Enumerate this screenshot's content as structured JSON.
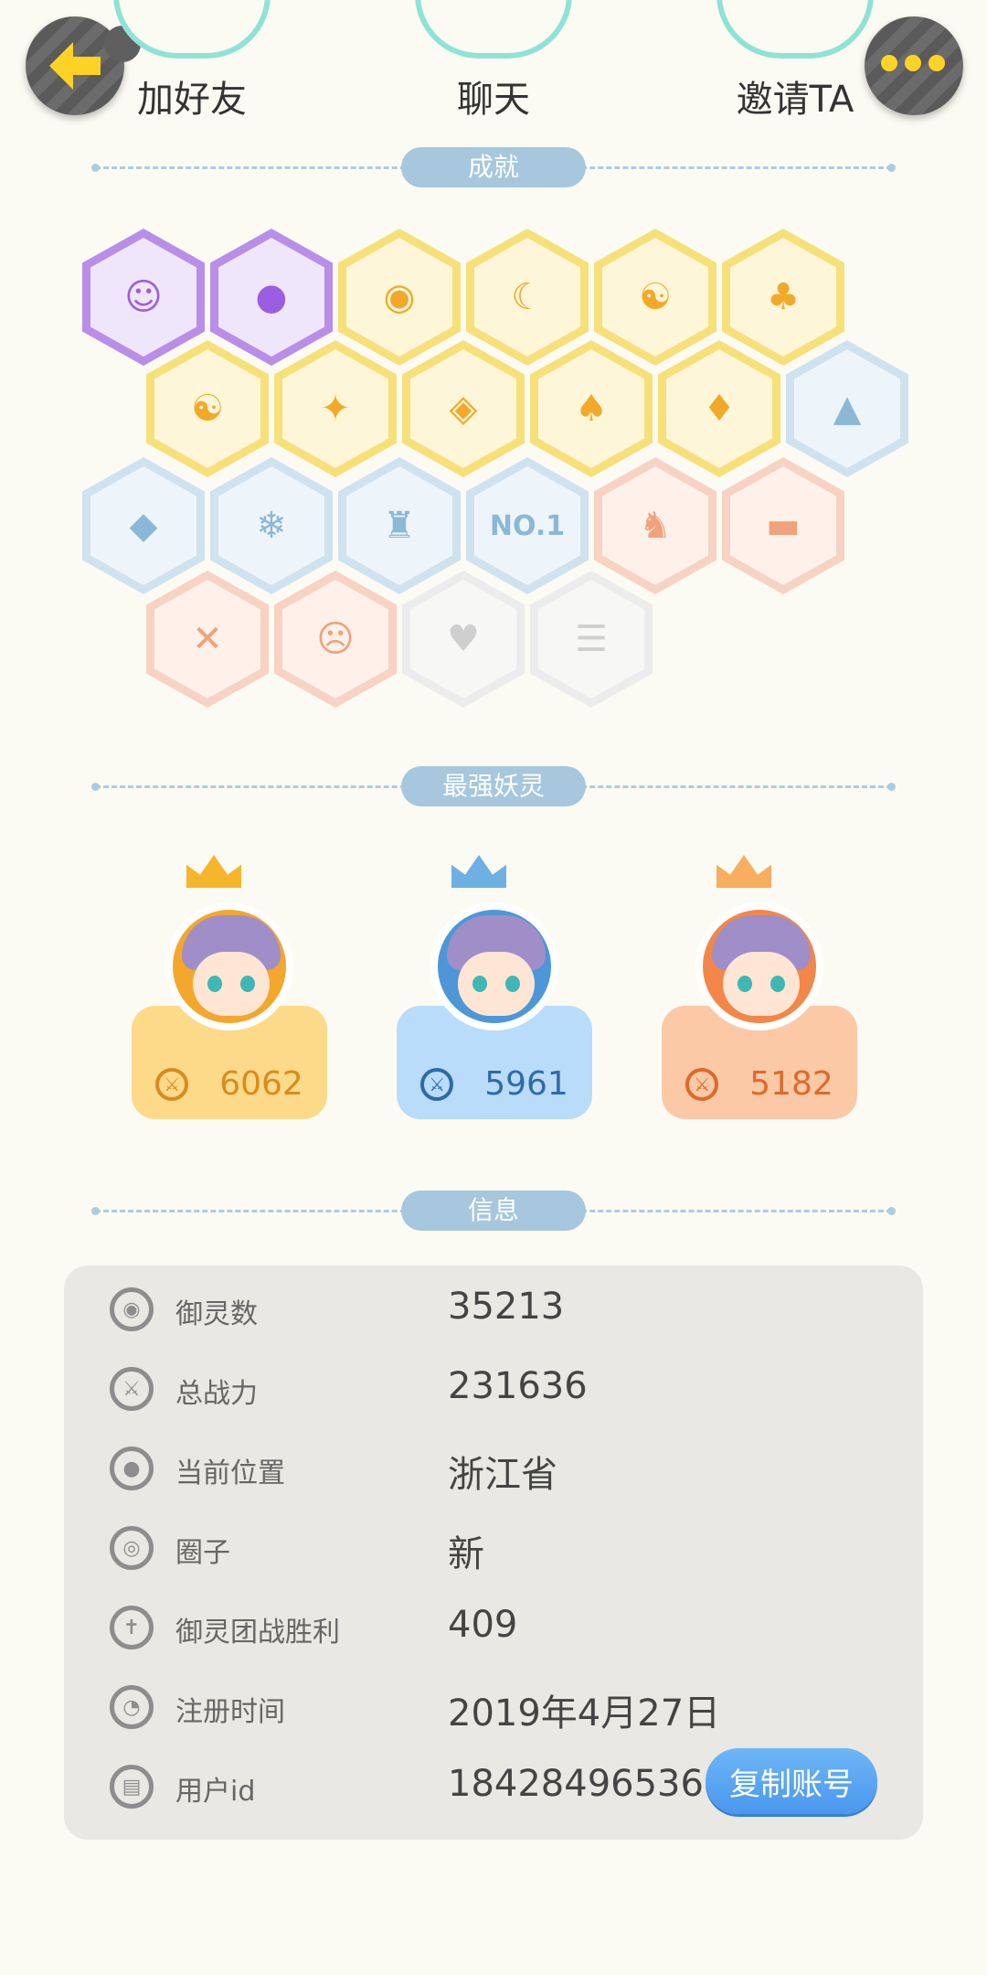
{
  "actions": {
    "add_friend": "加好友",
    "chat": "聊天",
    "invite": "邀请TA"
  },
  "sections": {
    "achievements": "成就",
    "top_spirits": "最强妖灵",
    "info": "信息"
  },
  "badges": [
    {
      "name": "devil-face-icon",
      "color": "purple",
      "glyph": "☺"
    },
    {
      "name": "crystal-ball-icon",
      "color": "purple",
      "glyph": "●"
    },
    {
      "name": "sun-tree-icon",
      "color": "gold",
      "glyph": "◉"
    },
    {
      "name": "moon-sun-icon",
      "color": "gold",
      "glyph": "☾"
    },
    {
      "name": "comet-yinyang-icon",
      "color": "gold",
      "glyph": "☯"
    },
    {
      "name": "cat-balloon-icon",
      "color": "gold",
      "glyph": "♣"
    },
    {
      "name": "yinyang-box-icon",
      "color": "gold",
      "glyph": "☯"
    },
    {
      "name": "dragon-icon",
      "color": "gold",
      "glyph": "✦"
    },
    {
      "name": "shield-icon",
      "color": "gold",
      "glyph": "◈"
    },
    {
      "name": "cat-silhouette-icon",
      "color": "gold",
      "glyph": "♠"
    },
    {
      "name": "fox-book-icon",
      "color": "gold",
      "glyph": "♦"
    },
    {
      "name": "sneaker-icon",
      "color": "blue",
      "glyph": "▲"
    },
    {
      "name": "crystal-egg-icon",
      "color": "blue",
      "glyph": "◆"
    },
    {
      "name": "ice-spirit-icon",
      "color": "blue",
      "glyph": "❄"
    },
    {
      "name": "monster-statue-icon",
      "color": "blue",
      "glyph": "♜"
    },
    {
      "name": "no1-icon",
      "color": "blue",
      "glyph": "NO.1"
    },
    {
      "name": "cat-cart-icon",
      "color": "peach",
      "glyph": "♞"
    },
    {
      "name": "belt-icon",
      "color": "peach",
      "glyph": "▬"
    },
    {
      "name": "crossed-swords-icon",
      "color": "peach",
      "glyph": "✕"
    },
    {
      "name": "angry-bun-icon",
      "color": "peach",
      "glyph": "☹"
    },
    {
      "name": "couple-heart-icon",
      "color": "gray",
      "glyph": "♥"
    },
    {
      "name": "cat-document-icon",
      "color": "gray",
      "glyph": "☰"
    }
  ],
  "top_spirits": [
    {
      "score": "6062"
    },
    {
      "score": "5961"
    },
    {
      "score": "5182"
    }
  ],
  "info": {
    "rows": [
      {
        "label": "御灵数",
        "value": "35213",
        "icon": "spirit-count-icon",
        "glyph": "◉"
      },
      {
        "label": "总战力",
        "value": "231636",
        "icon": "power-sword-icon",
        "glyph": "⚔"
      },
      {
        "label": "当前位置",
        "value": "浙江省",
        "icon": "location-pin-icon",
        "glyph": "●"
      },
      {
        "label": "圈子",
        "value": "新",
        "icon": "circle-target-icon",
        "glyph": "◎"
      },
      {
        "label": "御灵团战胜利",
        "value": "409",
        "icon": "victory-figure-icon",
        "glyph": "✝"
      },
      {
        "label": "注册时间",
        "value": "2019年4月27日",
        "icon": "clock-icon",
        "glyph": "◔"
      },
      {
        "label": "用户id",
        "value": "18428496536",
        "icon": "user-id-card-icon",
        "glyph": "▤"
      }
    ],
    "copy_button": "复制账号"
  }
}
